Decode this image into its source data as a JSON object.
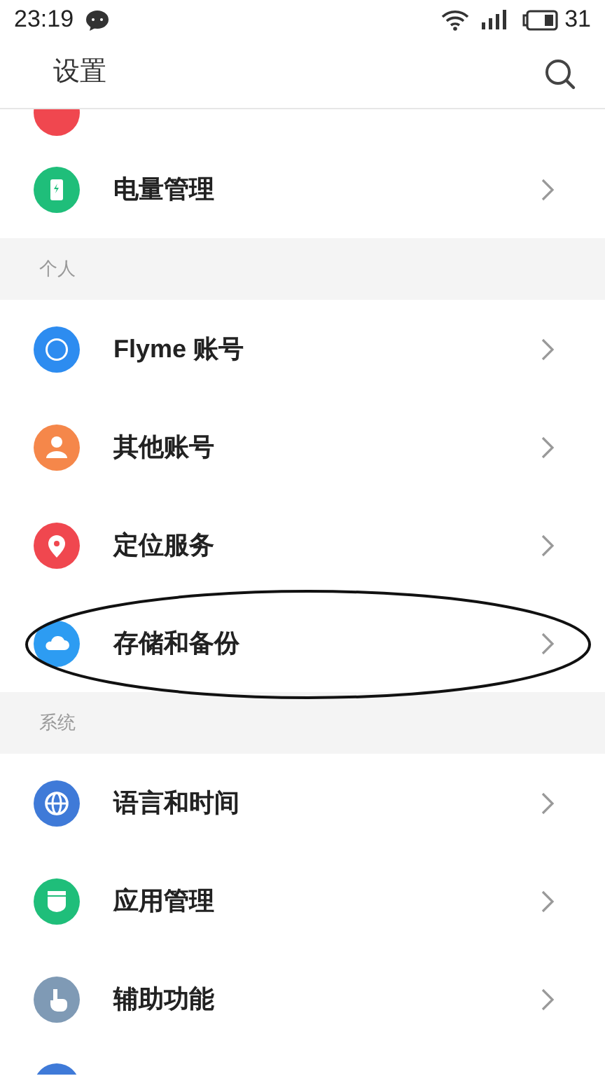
{
  "status_bar": {
    "time": "23:19",
    "battery": "31"
  },
  "header": {
    "title": "设置"
  },
  "sections": [
    {
      "items": [
        {
          "kind": "partial",
          "color": "#f0474f"
        },
        {
          "kind": "row",
          "label": "电量管理",
          "color": "#1fbe7a",
          "circled": false
        }
      ]
    },
    {
      "title": "个人",
      "items": [
        {
          "kind": "row",
          "label": "Flyme 账号",
          "color": "#2d8cf0",
          "circled": false
        },
        {
          "kind": "row",
          "label": "其他账号",
          "color": "#f5874a",
          "circled": false
        },
        {
          "kind": "row",
          "label": "定位服务",
          "color": "#f0474f",
          "circled": false
        },
        {
          "kind": "row",
          "label": "存储和备份",
          "color": "#2d9cf2",
          "circled": true
        }
      ]
    },
    {
      "title": "系统",
      "items": [
        {
          "kind": "row",
          "label": "语言和时间",
          "color": "#3f7ad8",
          "circled": false
        },
        {
          "kind": "row",
          "label": "应用管理",
          "color": "#1fbe7a",
          "circled": false
        },
        {
          "kind": "row",
          "label": "辅助功能",
          "color": "#7f9ab5",
          "circled": false
        },
        {
          "kind": "partial-bottom",
          "color": "#3f7ad8"
        }
      ]
    }
  ]
}
